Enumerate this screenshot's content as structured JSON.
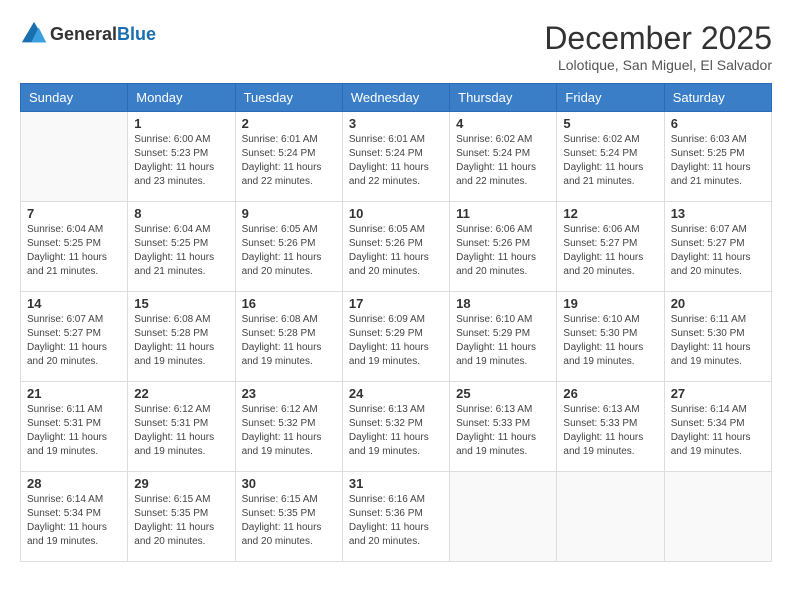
{
  "logo": {
    "general": "General",
    "blue": "Blue"
  },
  "title": {
    "month_year": "December 2025",
    "location": "Lolotique, San Miguel, El Salvador"
  },
  "headers": [
    "Sunday",
    "Monday",
    "Tuesday",
    "Wednesday",
    "Thursday",
    "Friday",
    "Saturday"
  ],
  "weeks": [
    [
      {
        "day": "",
        "sunrise": "",
        "sunset": "",
        "daylight": ""
      },
      {
        "day": "1",
        "sunrise": "Sunrise: 6:00 AM",
        "sunset": "Sunset: 5:23 PM",
        "daylight": "Daylight: 11 hours and 23 minutes."
      },
      {
        "day": "2",
        "sunrise": "Sunrise: 6:01 AM",
        "sunset": "Sunset: 5:24 PM",
        "daylight": "Daylight: 11 hours and 22 minutes."
      },
      {
        "day": "3",
        "sunrise": "Sunrise: 6:01 AM",
        "sunset": "Sunset: 5:24 PM",
        "daylight": "Daylight: 11 hours and 22 minutes."
      },
      {
        "day": "4",
        "sunrise": "Sunrise: 6:02 AM",
        "sunset": "Sunset: 5:24 PM",
        "daylight": "Daylight: 11 hours and 22 minutes."
      },
      {
        "day": "5",
        "sunrise": "Sunrise: 6:02 AM",
        "sunset": "Sunset: 5:24 PM",
        "daylight": "Daylight: 11 hours and 21 minutes."
      },
      {
        "day": "6",
        "sunrise": "Sunrise: 6:03 AM",
        "sunset": "Sunset: 5:25 PM",
        "daylight": "Daylight: 11 hours and 21 minutes."
      }
    ],
    [
      {
        "day": "7",
        "sunrise": "Sunrise: 6:04 AM",
        "sunset": "Sunset: 5:25 PM",
        "daylight": "Daylight: 11 hours and 21 minutes."
      },
      {
        "day": "8",
        "sunrise": "Sunrise: 6:04 AM",
        "sunset": "Sunset: 5:25 PM",
        "daylight": "Daylight: 11 hours and 21 minutes."
      },
      {
        "day": "9",
        "sunrise": "Sunrise: 6:05 AM",
        "sunset": "Sunset: 5:26 PM",
        "daylight": "Daylight: 11 hours and 20 minutes."
      },
      {
        "day": "10",
        "sunrise": "Sunrise: 6:05 AM",
        "sunset": "Sunset: 5:26 PM",
        "daylight": "Daylight: 11 hours and 20 minutes."
      },
      {
        "day": "11",
        "sunrise": "Sunrise: 6:06 AM",
        "sunset": "Sunset: 5:26 PM",
        "daylight": "Daylight: 11 hours and 20 minutes."
      },
      {
        "day": "12",
        "sunrise": "Sunrise: 6:06 AM",
        "sunset": "Sunset: 5:27 PM",
        "daylight": "Daylight: 11 hours and 20 minutes."
      },
      {
        "day": "13",
        "sunrise": "Sunrise: 6:07 AM",
        "sunset": "Sunset: 5:27 PM",
        "daylight": "Daylight: 11 hours and 20 minutes."
      }
    ],
    [
      {
        "day": "14",
        "sunrise": "Sunrise: 6:07 AM",
        "sunset": "Sunset: 5:27 PM",
        "daylight": "Daylight: 11 hours and 20 minutes."
      },
      {
        "day": "15",
        "sunrise": "Sunrise: 6:08 AM",
        "sunset": "Sunset: 5:28 PM",
        "daylight": "Daylight: 11 hours and 19 minutes."
      },
      {
        "day": "16",
        "sunrise": "Sunrise: 6:08 AM",
        "sunset": "Sunset: 5:28 PM",
        "daylight": "Daylight: 11 hours and 19 minutes."
      },
      {
        "day": "17",
        "sunrise": "Sunrise: 6:09 AM",
        "sunset": "Sunset: 5:29 PM",
        "daylight": "Daylight: 11 hours and 19 minutes."
      },
      {
        "day": "18",
        "sunrise": "Sunrise: 6:10 AM",
        "sunset": "Sunset: 5:29 PM",
        "daylight": "Daylight: 11 hours and 19 minutes."
      },
      {
        "day": "19",
        "sunrise": "Sunrise: 6:10 AM",
        "sunset": "Sunset: 5:30 PM",
        "daylight": "Daylight: 11 hours and 19 minutes."
      },
      {
        "day": "20",
        "sunrise": "Sunrise: 6:11 AM",
        "sunset": "Sunset: 5:30 PM",
        "daylight": "Daylight: 11 hours and 19 minutes."
      }
    ],
    [
      {
        "day": "21",
        "sunrise": "Sunrise: 6:11 AM",
        "sunset": "Sunset: 5:31 PM",
        "daylight": "Daylight: 11 hours and 19 minutes."
      },
      {
        "day": "22",
        "sunrise": "Sunrise: 6:12 AM",
        "sunset": "Sunset: 5:31 PM",
        "daylight": "Daylight: 11 hours and 19 minutes."
      },
      {
        "day": "23",
        "sunrise": "Sunrise: 6:12 AM",
        "sunset": "Sunset: 5:32 PM",
        "daylight": "Daylight: 11 hours and 19 minutes."
      },
      {
        "day": "24",
        "sunrise": "Sunrise: 6:13 AM",
        "sunset": "Sunset: 5:32 PM",
        "daylight": "Daylight: 11 hours and 19 minutes."
      },
      {
        "day": "25",
        "sunrise": "Sunrise: 6:13 AM",
        "sunset": "Sunset: 5:33 PM",
        "daylight": "Daylight: 11 hours and 19 minutes."
      },
      {
        "day": "26",
        "sunrise": "Sunrise: 6:13 AM",
        "sunset": "Sunset: 5:33 PM",
        "daylight": "Daylight: 11 hours and 19 minutes."
      },
      {
        "day": "27",
        "sunrise": "Sunrise: 6:14 AM",
        "sunset": "Sunset: 5:34 PM",
        "daylight": "Daylight: 11 hours and 19 minutes."
      }
    ],
    [
      {
        "day": "28",
        "sunrise": "Sunrise: 6:14 AM",
        "sunset": "Sunset: 5:34 PM",
        "daylight": "Daylight: 11 hours and 19 minutes."
      },
      {
        "day": "29",
        "sunrise": "Sunrise: 6:15 AM",
        "sunset": "Sunset: 5:35 PM",
        "daylight": "Daylight: 11 hours and 20 minutes."
      },
      {
        "day": "30",
        "sunrise": "Sunrise: 6:15 AM",
        "sunset": "Sunset: 5:35 PM",
        "daylight": "Daylight: 11 hours and 20 minutes."
      },
      {
        "day": "31",
        "sunrise": "Sunrise: 6:16 AM",
        "sunset": "Sunset: 5:36 PM",
        "daylight": "Daylight: 11 hours and 20 minutes."
      },
      {
        "day": "",
        "sunrise": "",
        "sunset": "",
        "daylight": ""
      },
      {
        "day": "",
        "sunrise": "",
        "sunset": "",
        "daylight": ""
      },
      {
        "day": "",
        "sunrise": "",
        "sunset": "",
        "daylight": ""
      }
    ]
  ]
}
